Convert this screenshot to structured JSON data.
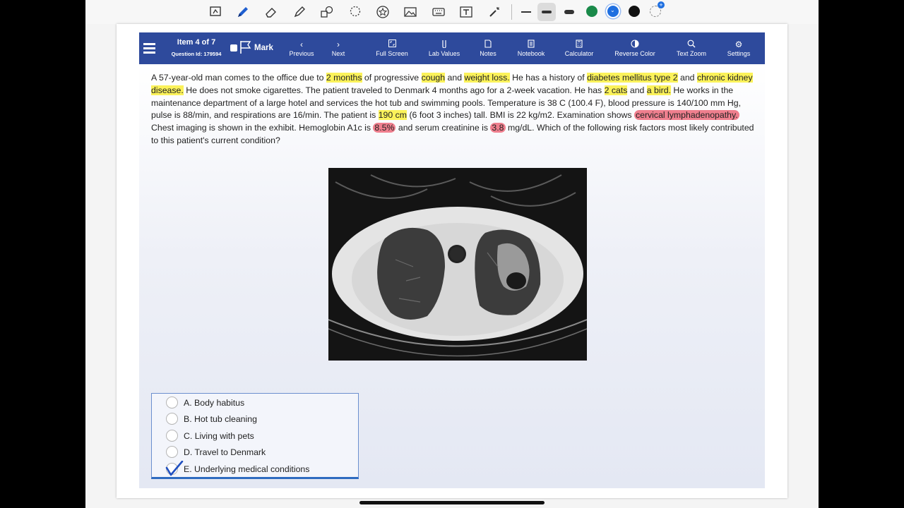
{
  "draw_toolbar": {
    "tools": [
      "lasso-select-icon",
      "pen-icon",
      "eraser-icon",
      "highlighter-icon",
      "shapes-icon",
      "lasso-icon",
      "sticker-icon",
      "image-icon",
      "keyboard-icon",
      "text-box-icon",
      "laser-pointer-icon"
    ],
    "colors": [
      "#1a8a4a",
      "#1f6fe0",
      "#111111"
    ]
  },
  "header": {
    "item_label": "Item 4 of 7",
    "question_id": "Question Id: 179594",
    "mark": "Mark",
    "nav": [
      {
        "label": "Previous",
        "icon": "chevron-left-icon"
      },
      {
        "label": "Next",
        "icon": "chevron-right-icon"
      },
      {
        "label": "Full Screen",
        "icon": "fullscreen-icon"
      },
      {
        "label": "Lab Values",
        "icon": "test-tube-icon"
      },
      {
        "label": "Notes",
        "icon": "notes-icon"
      },
      {
        "label": "Notebook",
        "icon": "notebook-icon"
      },
      {
        "label": "Calculator",
        "icon": "calculator-icon"
      },
      {
        "label": "Reverse Color",
        "icon": "reverse-color-icon"
      },
      {
        "label": "Text Zoom",
        "icon": "zoom-icon"
      },
      {
        "label": "Settings",
        "icon": "gear-icon"
      }
    ]
  },
  "stem": {
    "s1": "A 57-year-old man comes to the office due to ",
    "h1": "2 months",
    "s2": " of progressive ",
    "h2": "cough",
    "s3": " and ",
    "h3": "weight loss.",
    "s4": "  He has a history of ",
    "h4": "diabetes mellitus type 2",
    "s5": " and ",
    "h5": "chronic kidney disease.",
    "s6": "  He does not smoke cigarettes.  The patient traveled to Denmark 4 months ago for a 2-week vacation.  He has ",
    "h6": "2 cats",
    "s7": " and ",
    "h7": "a bird.",
    "s8": "  He works in the maintenance department of a large hotel and services the hot tub and swimming pools.  Temperature is 38 C (100.4 F), blood pressure is 140/100 mm Hg, pulse is 88/min, and respirations are 16/min.  The patient is ",
    "h8": "190 cm",
    "s9": " (6 foot 3 inches) tall.  BMI is 22 kg/m2.  Examination shows ",
    "r1": "cervical lymphadenopathy.",
    "s10": "  Chest imaging is shown in the exhibit.  Hemoglobin A1c is ",
    "r2": "8.5%",
    "s11": " and serum creatinine is ",
    "r3": "3.8",
    "s12": " mg/dL.  Which of the following risk factors most likely contributed to this patient's current condition?"
  },
  "choices": [
    {
      "text": "A. Body habitus",
      "selected": false
    },
    {
      "text": "B. Hot tub cleaning",
      "selected": false
    },
    {
      "text": "C. Living with pets",
      "selected": false
    },
    {
      "text": "D. Travel to Denmark",
      "selected": false
    },
    {
      "text": "E. Underlying medical conditions",
      "selected": true
    }
  ]
}
